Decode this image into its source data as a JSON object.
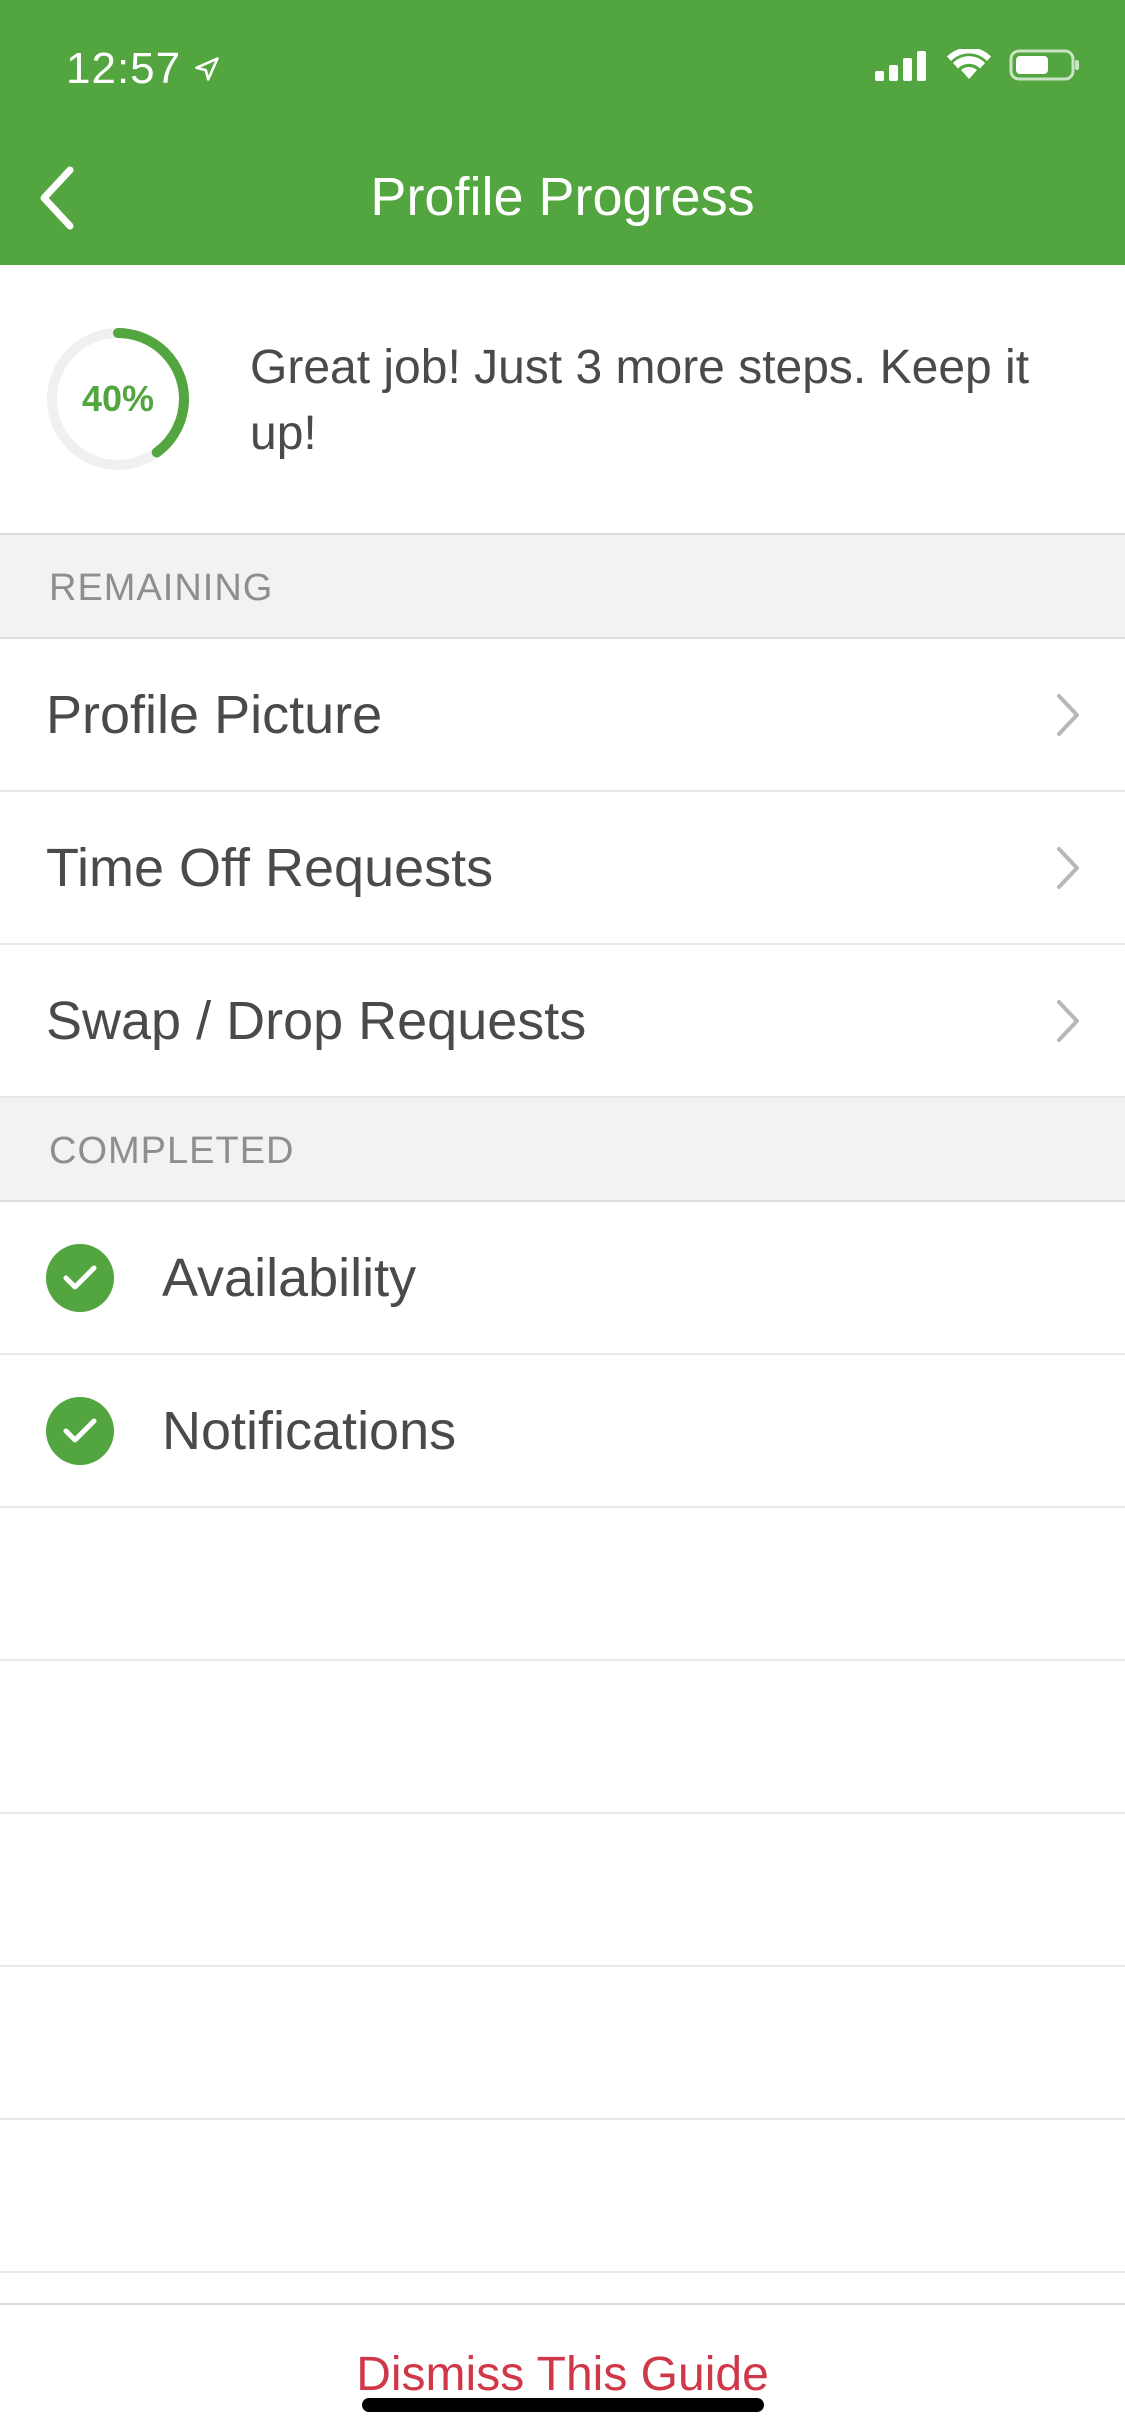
{
  "status_bar": {
    "time": "12:57"
  },
  "header": {
    "title": "Profile Progress"
  },
  "progress": {
    "percent_label": "40%",
    "percent_value": 0.4,
    "message": "Great job! Just 3 more steps. Keep it up!"
  },
  "remaining": {
    "title": "REMAINING",
    "items": [
      {
        "label": "Profile Picture"
      },
      {
        "label": "Time Off Requests"
      },
      {
        "label": "Swap / Drop Requests"
      }
    ]
  },
  "completed": {
    "title": "COMPLETED",
    "items": [
      {
        "label": "Availability"
      },
      {
        "label": "Notifications"
      }
    ]
  },
  "footer": {
    "dismiss_label": "Dismiss This Guide"
  },
  "colors": {
    "brand": "#52a53f",
    "danger": "#d0384a"
  }
}
